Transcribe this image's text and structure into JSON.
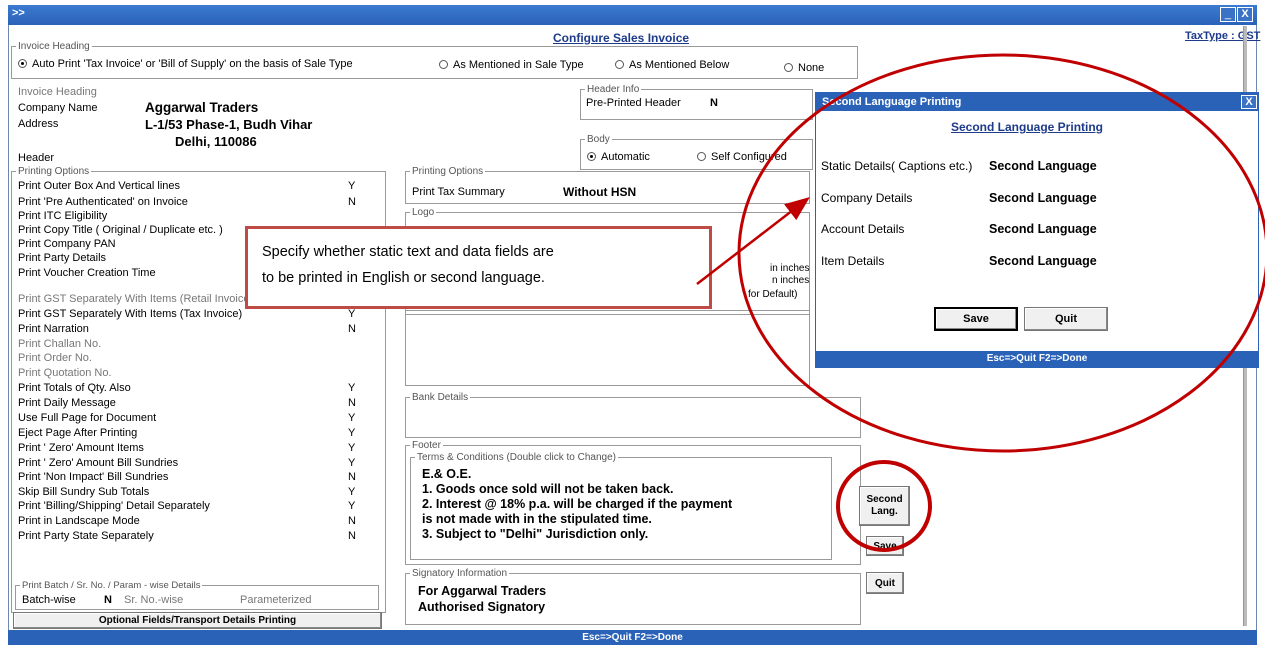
{
  "window": {
    "minimize_icon": "_",
    "close_icon": "X",
    "expand_icon": ">>",
    "title": "Configure Sales Invoice",
    "tax_type": "TaxType : GST",
    "status": "Esc=>Quit   F2=>Done"
  },
  "invoice_heading_group": {
    "legend": "Invoice Heading",
    "options": [
      {
        "label": "Auto Print 'Tax Invoice' or  'Bill of Supply' on the basis of Sale Type",
        "selected": true
      },
      {
        "label": "As Mentioned in Sale Type",
        "selected": false
      },
      {
        "label": "As Mentioned Below",
        "selected": false
      },
      {
        "label": "None",
        "selected": false
      }
    ]
  },
  "company": {
    "invoice_heading_label": "Invoice Heading",
    "name_label": "Company Name",
    "name": "Aggarwal Traders",
    "address_label": "Address",
    "address_line1": "L-1/53 Phase-1, Budh Vihar",
    "address_line2": "Delhi, 110086",
    "header_label": "Header"
  },
  "header_info": {
    "legend": "Header Info",
    "label": "Pre-Printed Header",
    "value": "N"
  },
  "body_group": {
    "legend": "Body",
    "options": [
      {
        "label": "Automatic",
        "selected": true
      },
      {
        "label": "Self Configured",
        "selected": false
      }
    ]
  },
  "printing_options_left": {
    "legend": "Printing Options",
    "items": [
      {
        "label": "Print Outer Box And Vertical lines",
        "value": "Y",
        "dim": false
      },
      {
        "label": "Print 'Pre Authenticated' on Invoice",
        "value": "N",
        "dim": false
      },
      {
        "label": "Print ITC Eligibility",
        "value": "",
        "dim": false
      },
      {
        "label": "Print Copy Title ( Original / Duplicate etc. )",
        "value": "",
        "dim": false
      },
      {
        "label": "Print Company PAN",
        "value": "",
        "dim": false
      },
      {
        "label": "Print Party Details",
        "value": "",
        "dim": false
      },
      {
        "label": "Print Voucher Creation Time",
        "value": "",
        "dim": false
      },
      {
        "label": "Print GST Separately With Items (Retail Invoice)",
        "value": "Y",
        "dim": true
      },
      {
        "label": "Print GST Separately With Items (Tax Invoice)",
        "value": "Y",
        "dim": false
      },
      {
        "label": "Print Narration",
        "value": "N",
        "dim": false
      },
      {
        "label": "Print Challan No.",
        "value": "",
        "dim": true
      },
      {
        "label": "Print Order No.",
        "value": "",
        "dim": true
      },
      {
        "label": "Print Quotation No.",
        "value": "",
        "dim": true
      },
      {
        "label": "Print Totals of Qty. Also",
        "value": "Y",
        "dim": false
      },
      {
        "label": "Print Daily Message",
        "value": "N",
        "dim": false
      },
      {
        "label": "Use Full Page for Document",
        "value": "Y",
        "dim": false
      },
      {
        "label": "Eject Page After Printing",
        "value": "Y",
        "dim": false
      },
      {
        "label": "Print ' Zero' Amount Items",
        "value": "Y",
        "dim": false
      },
      {
        "label": "Print ' Zero' Amount Bill Sundries",
        "value": "Y",
        "dim": false
      },
      {
        "label": "Print 'Non Impact' Bill Sundries",
        "value": "N",
        "dim": false
      },
      {
        "label": "Skip Bill Sundry Sub Totals",
        "value": "Y",
        "dim": false
      },
      {
        "label": "Print 'Billing/Shipping' Detail Separately",
        "value": "Y",
        "dim": false
      },
      {
        "label": "Print in Landscape Mode",
        "value": "N",
        "dim": false
      },
      {
        "label": "Print Party State Separately",
        "value": "N",
        "dim": false
      }
    ]
  },
  "batch_group": {
    "legend": "Print Batch / Sr. No. / Param - wise Details",
    "batch_label": "Batch-wise",
    "batch_value": "N",
    "srno_label": "Sr. No.-wise",
    "param_label": "Parameterized"
  },
  "optional_fields_button": "Optional Fields/Transport Details Printing",
  "printing_options_right": {
    "legend": "Printing Options",
    "label": "Print Tax Summary",
    "value": "Without HSN"
  },
  "logo_group": {
    "legend": "Logo",
    "hint1": "in inches",
    "hint2": "n inches",
    "hint3": "for Default)"
  },
  "bank_details": {
    "legend": "Bank Details"
  },
  "footer": {
    "legend": "Footer",
    "terms_legend": "Terms & Conditions (Double click to Change)",
    "lines": [
      "E.& O.E.",
      "1. Goods once sold will not be taken back.",
      "2. Interest @ 18% p.a. will be charged if the payment",
      "is not made with in the stipulated time.",
      "3. Subject to \"Delhi\" Jurisdiction only."
    ]
  },
  "signatory": {
    "legend": "Signatory Information",
    "line1": "For Aggarwal Traders",
    "line2": "Authorised Signatory"
  },
  "side_buttons": {
    "second_lang_line1": "Second",
    "second_lang_line2": "Lang.",
    "save": "Save",
    "quit": "Quit"
  },
  "dialog": {
    "title": "Second Language Printing",
    "heading": "Second Language Printing",
    "close_icon": "X",
    "rows": [
      {
        "label": "Static Details( Captions etc.)",
        "value": "Second Language"
      },
      {
        "label": "Company Details",
        "value": "Second Language"
      },
      {
        "label": "Account Details",
        "value": "Second Language"
      },
      {
        "label": "Item Details",
        "value": "Second Language"
      }
    ],
    "save": "Save",
    "quit": "Quit",
    "status": "Esc=>Quit   F2=>Done"
  },
  "callout": {
    "line1": "Specify whether static text and data fields are",
    "line2": "to be printed in English or second language."
  },
  "colors": {
    "title_bar": "#2a62b8",
    "annotation": "#c00000",
    "callout_border": "#bf4b47"
  }
}
